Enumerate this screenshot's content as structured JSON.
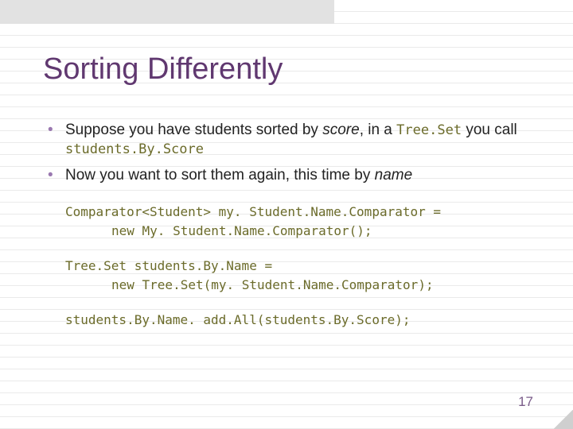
{
  "title": "Sorting Differently",
  "bullets": {
    "b1": {
      "part1": "Suppose you have students sorted by ",
      "score": "score",
      "part2": ", in a ",
      "treeset": "Tree.Set",
      "part3": " you call ",
      "var": "students.By.Score"
    },
    "b2": {
      "part1": "Now you want to sort them again, this time by ",
      "name": "name"
    }
  },
  "code": {
    "l1": "Comparator<Student> my. Student.Name.Comparator =",
    "l2": "new My. Student.Name.Comparator();",
    "l3": "Tree.Set students.By.Name =",
    "l4": "new Tree.Set(my. Student.Name.Comparator);",
    "l5": "students.By.Name. add.All(students.By.Score);"
  },
  "slide_number": "17"
}
